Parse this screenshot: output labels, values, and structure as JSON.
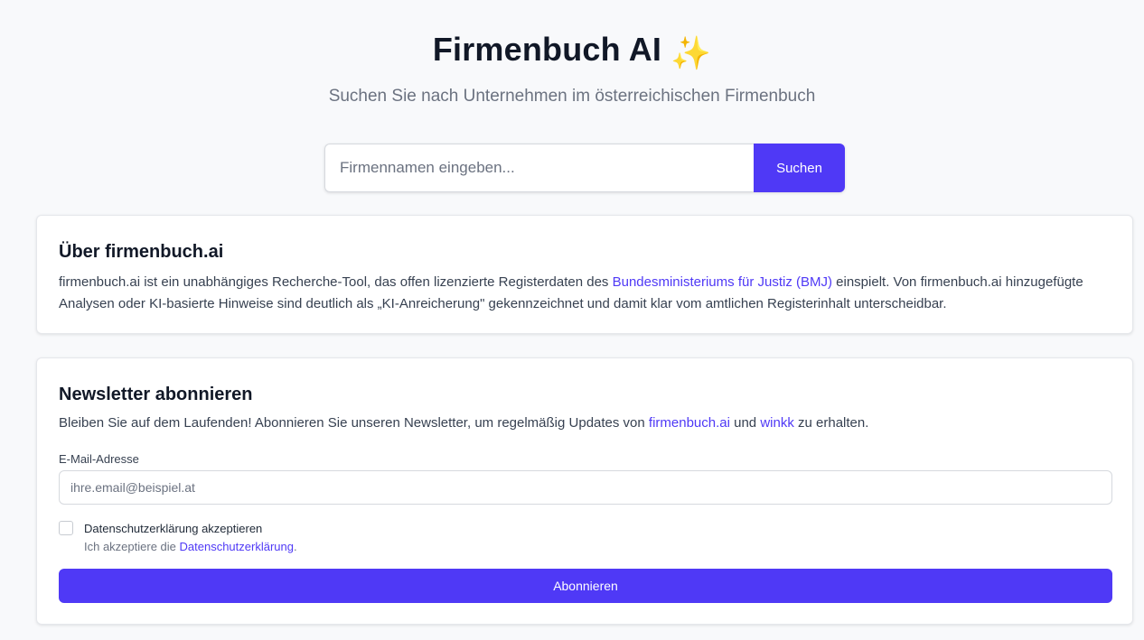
{
  "header": {
    "title": "Firmenbuch AI",
    "title_emoji": "✨",
    "subtitle": "Suchen Sie nach Unternehmen im österreichischen Firmenbuch"
  },
  "search": {
    "placeholder": "Firmennamen eingeben...",
    "value": "",
    "button_label": "Suchen"
  },
  "about": {
    "title": "Über firmenbuch.ai",
    "text_before_link": "firmenbuch.ai ist ein unabhängiges Recherche-Tool, das offen lizenzierte Registerdaten des ",
    "link_text": "Bundesministeriums für Justiz (BMJ)",
    "text_after_link": " einspielt. Von firmenbuch.ai hinzugefügte Analysen oder KI-basierte Hinweise sind deutlich als „KI-Anreicherung\" gekennzeichnet und damit klar vom amtlichen Registerinhalt unterscheidbar."
  },
  "newsletter": {
    "title": "Newsletter abonnieren",
    "intro_before": "Bleiben Sie auf dem Laufenden! Abonnieren Sie unseren Newsletter, um regelmäßig Updates von ",
    "intro_link1": "firmenbuch.ai",
    "intro_middle": " und ",
    "intro_link2": "winkk",
    "intro_after": " zu erhalten.",
    "email_label": "E-Mail-Adresse",
    "email_placeholder": "ihre.email@beispiel.at",
    "email_value": "",
    "consent_label": "Datenschutzerklärung akzeptieren",
    "consent_checked": false,
    "consent_help_before": "Ich akzeptiere die ",
    "consent_help_link": "Datenschutzerklärung",
    "consent_help_after": ".",
    "subscribe_label": "Abonnieren"
  },
  "colors": {
    "accent": "#4f39f6",
    "background": "#f8f9fb",
    "card": "#ffffff",
    "title": "#111827",
    "muted": "#6b7280"
  }
}
